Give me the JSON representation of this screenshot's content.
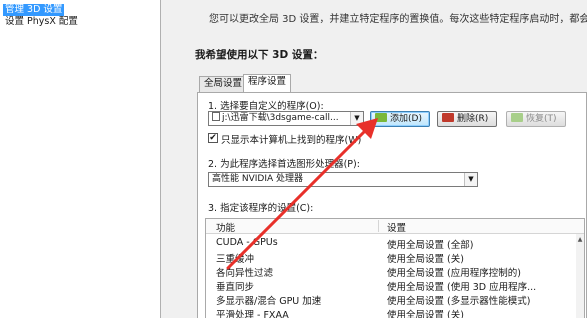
{
  "nav": {
    "items": [
      {
        "label": "管理 3D 设置",
        "selected": true
      },
      {
        "label": "设置 PhysX 配置",
        "selected": false
      }
    ]
  },
  "content": {
    "intro": "您可以更改全局 3D 设置，并建立特定程序的置换值。每次这些特定程序启动时，都会自动",
    "section_title": "我希望使用以下 3D 设置：",
    "tabs": [
      {
        "label": "全局设置",
        "active": false
      },
      {
        "label": "程序设置",
        "active": true
      }
    ],
    "step1_label": "1. 选择要自定义的程序(O):",
    "program_select": {
      "value": "j:\\迅雷下载\\3dsgame-call..."
    },
    "buttons": {
      "add": "添加(D)",
      "delete": "删除(R)",
      "restore": "恢复(T)"
    },
    "checkbox": {
      "label": "只显示本计算机上找到的程序(W)",
      "checked": true,
      "mark": "✔"
    },
    "step2_label": "2. 为此程序选择首选图形处理器(P):",
    "gpu_select": {
      "value": "高性能 NVIDIA 处理器"
    },
    "step3_label": "3. 指定该程序的设置(C):",
    "table": {
      "columns": [
        "功能",
        "设置"
      ],
      "rows": [
        {
          "feature": "CUDA - GPUs",
          "setting": "使用全局设置 (全部)"
        },
        {
          "feature": "三重缓冲",
          "setting": "使用全局设置 (关)"
        },
        {
          "feature": "各向异性过滤",
          "setting": "使用全局设置 (应用程序控制的)"
        },
        {
          "feature": "垂直同步",
          "setting": "使用全局设置 (使用 3D 应用程序..."
        },
        {
          "feature": "多显示器/混合 GPU 加速",
          "setting": "使用全局设置 (多显示器性能模式)"
        },
        {
          "feature": "平滑处理 - FXAA",
          "setting": "使用全局设置 (关)"
        }
      ]
    }
  },
  "annotation": {
    "arrow_color": "#e8302a"
  },
  "colors": {
    "selection": "#3399ff",
    "button_green": "#7ab83b",
    "button_red": "#c0392b"
  }
}
